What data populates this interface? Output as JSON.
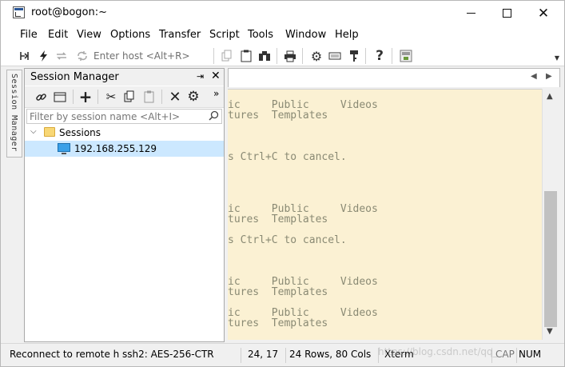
{
  "window": {
    "title": "root@bogon:~",
    "minimize": "—",
    "maximize": "□",
    "close": "✕"
  },
  "menu": [
    "File",
    "Edit",
    "View",
    "Options",
    "Transfer",
    "Script",
    "Tools",
    "Window",
    "Help"
  ],
  "toolbar": {
    "host_placeholder": "Enter host <Alt+R>",
    "icons": [
      "connect-bar-icon",
      "quick-connect-icon",
      "reconnect-icon",
      "disconnect-icon",
      "copy-icon",
      "paste-icon",
      "find-icon",
      "print-icon",
      "settings-icon",
      "keymap-icon",
      "key-icon",
      "help-icon",
      "sftp-icon"
    ]
  },
  "side_tab": {
    "label": "Session Manager"
  },
  "session_manager": {
    "title": "Session Manager",
    "pin": "⇥",
    "close": "✕",
    "more": "»",
    "filter_placeholder": "Filter by session name <Alt+I>",
    "tree": [
      {
        "label": "Sessions",
        "type": "folder",
        "expanded": true
      },
      {
        "label": "192.168.255.129",
        "type": "session",
        "selected": true
      }
    ]
  },
  "terminal": {
    "lines": [
      "ic     Public     Videos",
      "tures  Templates",
      "",
      "",
      "s Ctrl+C to cancel.",
      "",
      "",
      "",
      "",
      "ic     Public     Videos",
      "tures  Templates",
      "",
      "s Ctrl+C to cancel.",
      "",
      "",
      "",
      "ic     Public     Videos",
      "tures  Templates",
      "",
      "ic     Public     Videos",
      "tures  Templates"
    ],
    "colors": {
      "background": "#fbf1d3",
      "text": "#8a8a74"
    }
  },
  "status": {
    "message": "Reconnect to remote h",
    "protocol": "ssh2: AES-256-CTR",
    "cursor": "24,  17",
    "dimensions": "24 Rows, 80 Cols",
    "terminal_type": "Xterm",
    "caps": "CAP",
    "num": "NUM"
  },
  "watermark": "https://blog.csdn.net/qq_"
}
